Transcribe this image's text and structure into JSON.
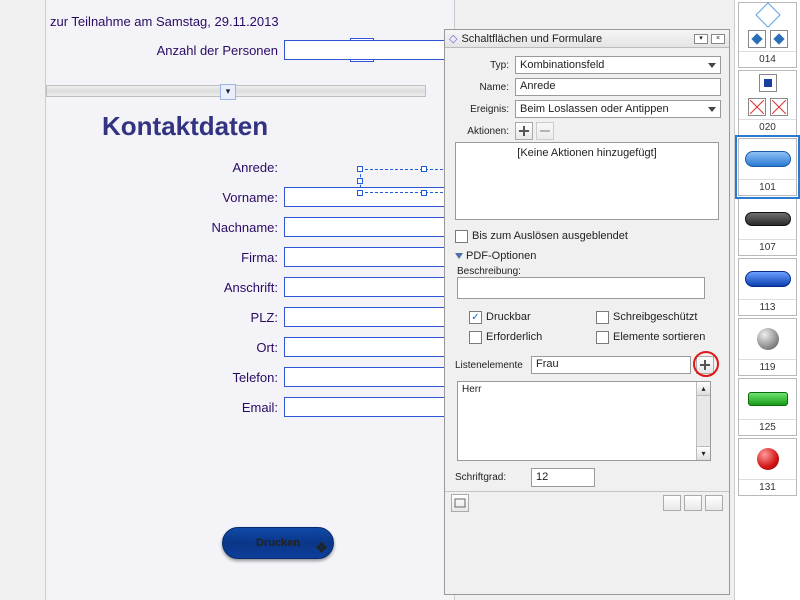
{
  "page": {
    "sat_label": "zur Teilnahme am Samstag, 29.11.2013",
    "persons_label": "Anzahl der Personen",
    "section_title": "Kontaktdaten",
    "fields": {
      "anrede": "Anrede:",
      "vorname": "Vorname:",
      "nachname": "Nachname:",
      "firma": "Firma:",
      "anschrift": "Anschrift:",
      "plz": "PLZ:",
      "ort": "Ort:",
      "telefon": "Telefon:",
      "email": "Email:"
    },
    "print_button": "Drucken"
  },
  "panel": {
    "title": "Schaltflächen und Formulare",
    "typ_label": "Typ:",
    "typ_value": "Kombinationsfeld",
    "name_label": "Name:",
    "name_value": "Anrede",
    "ereignis_label": "Ereignis:",
    "ereignis_value": "Beim Loslassen oder Antippen",
    "aktionen_label": "Aktionen:",
    "actions_empty": "[Keine Aktionen hinzugefügt]",
    "chk_hidden": "Bis zum Auslösen ausgeblendet",
    "pdf_section": "PDF-Optionen",
    "beschreibung_label": "Beschreibung:",
    "chk_druckbar": "Druckbar",
    "chk_schreib": "Schreibgeschützt",
    "chk_erforderlich": "Erforderlich",
    "chk_sortieren": "Elemente sortieren",
    "listenelemente_label": "Listenelemente",
    "listenelemente_value": "Frau",
    "list_item_1": "Herr",
    "schriftgrad_label": "Schriftgrad:",
    "schriftgrad_value": "12"
  },
  "palette": {
    "g1": "014",
    "g2": "020",
    "g3": "101",
    "g4": "107",
    "g5": "113",
    "g6": "119",
    "g7": "125",
    "g8": "131"
  }
}
